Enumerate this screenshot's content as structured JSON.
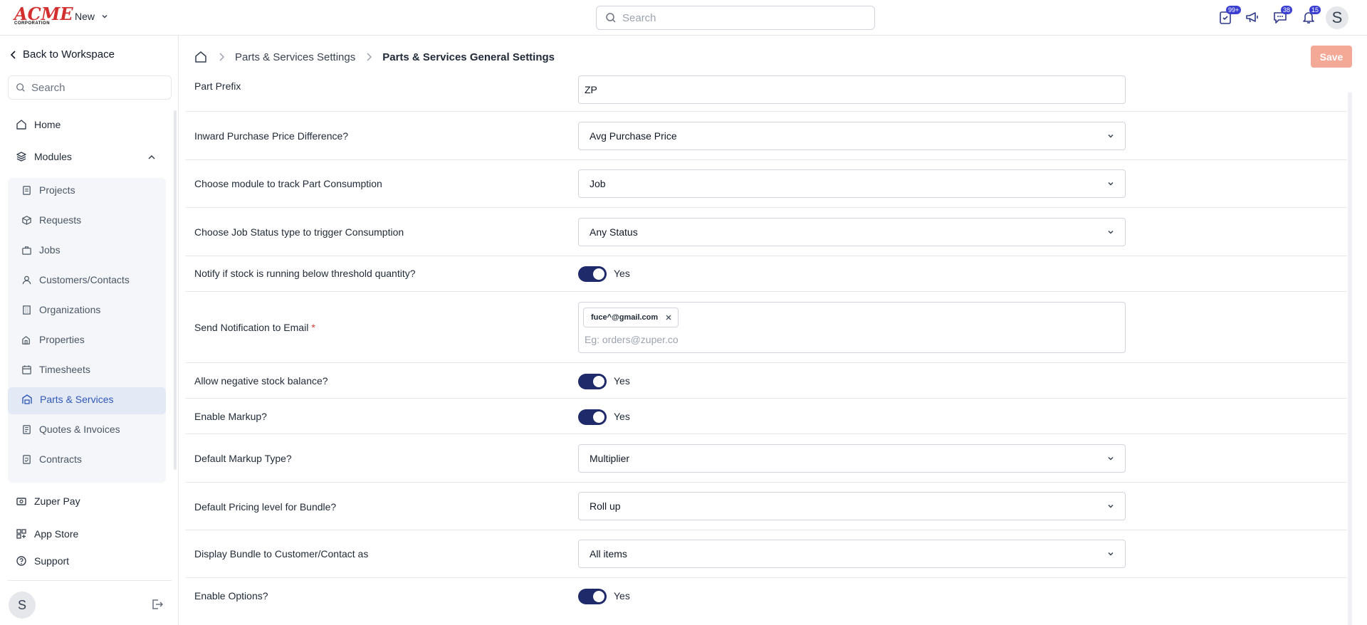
{
  "topbar": {
    "logo_text": "ACME",
    "logo_subtext": "CORPORATION",
    "new_label": "New",
    "search_placeholder": "Search",
    "badges": {
      "tasks": "99+",
      "chat": "38",
      "notifications": "15"
    },
    "avatar_initial": "S"
  },
  "sidebar": {
    "back_label": "Back to Workspace",
    "search_placeholder": "Search",
    "home": "Home",
    "modules": "Modules",
    "sub_items": [
      "Projects",
      "Requests",
      "Jobs",
      "Customers/Contacts",
      "Organizations",
      "Properties",
      "Timesheets",
      "Parts & Services",
      "Quotes & Invoices",
      "Contracts"
    ],
    "zuper_pay": "Zuper Pay",
    "app_store": "App Store",
    "support": "Support",
    "avatar_initial": "S"
  },
  "breadcrumb": {
    "parent": "Parts & Services Settings",
    "current": "Parts & Services General Settings"
  },
  "save_label": "Save",
  "settings": {
    "part_prefix": {
      "label": "Part Prefix",
      "value": "ZP"
    },
    "inward_price": {
      "label": "Inward Purchase Price Difference?",
      "value": "Avg Purchase Price"
    },
    "consumption_module": {
      "label": "Choose module to track Part Consumption",
      "value": "Job"
    },
    "job_status": {
      "label": "Choose Job Status type to trigger Consumption",
      "value": "Any Status"
    },
    "notify_threshold": {
      "label": "Notify if stock is running below threshold quantity?",
      "value": "Yes"
    },
    "notification_email": {
      "label": "Send Notification to Email",
      "required_mark": "*",
      "chip": "fuce^@gmail.com",
      "placeholder": "Eg: orders@zuper.co"
    },
    "negative_stock": {
      "label": "Allow negative stock balance?",
      "value": "Yes"
    },
    "enable_markup": {
      "label": "Enable Markup?",
      "value": "Yes"
    },
    "markup_type": {
      "label": "Default Markup Type?",
      "value": "Multiplier"
    },
    "bundle_pricing": {
      "label": "Default Pricing level for Bundle?",
      "value": "Roll up"
    },
    "bundle_display": {
      "label": "Display Bundle to Customer/Contact as",
      "value": "All items"
    },
    "enable_options": {
      "label": "Enable Options?",
      "value": "Yes"
    }
  },
  "colors": {
    "brand_red": "#d32f2f",
    "toggle_on": "#1f2a6b",
    "active_nav_bg": "#e3eaf6",
    "active_nav_text": "#2f57b5",
    "save_disabled": "#f4a896",
    "badge": "#3b3fd1"
  }
}
